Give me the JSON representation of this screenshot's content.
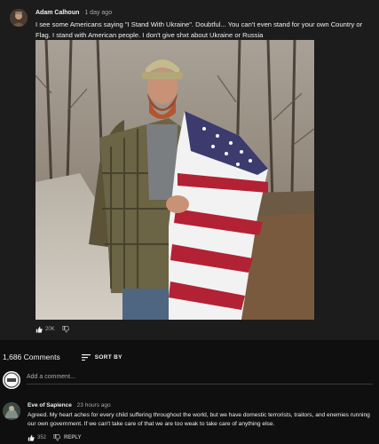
{
  "post": {
    "author": "Adam Calhoun",
    "timestamp": "1 day ago",
    "text": "I see some Americans saying \"I Stand With Ukraine\". Doubtful... You can't even stand for your own Country or Flag. I stand with American people. I don't give shxt about Ukraine or Russia",
    "likes": "20K",
    "like_icon": "thumbs-up-icon",
    "dislike_icon": "thumbs-down-icon"
  },
  "comments_section": {
    "count_label": "1,686 Comments",
    "sort_label": "SORT BY",
    "sort_icon": "sort-icon",
    "input_placeholder": "Add a comment..."
  },
  "comment": {
    "author": "Eve of Sapience",
    "timestamp": "23 hours ago",
    "text": "Agreed. My heart aches for every child suffering throughout the world, but we have domestic terrorists, traitors, and enemies running our own government. If we can't take care of that we are too weak to take care of anything else.",
    "likes": "352",
    "reply_label": "REPLY"
  },
  "colors": {
    "background": "#0f0f0f",
    "card": "#1c1c1c",
    "text_primary": "#f1f1f1",
    "text_secondary": "#aaaaaa",
    "flag_red": "#b22234",
    "flag_blue": "#3c3b6e"
  }
}
